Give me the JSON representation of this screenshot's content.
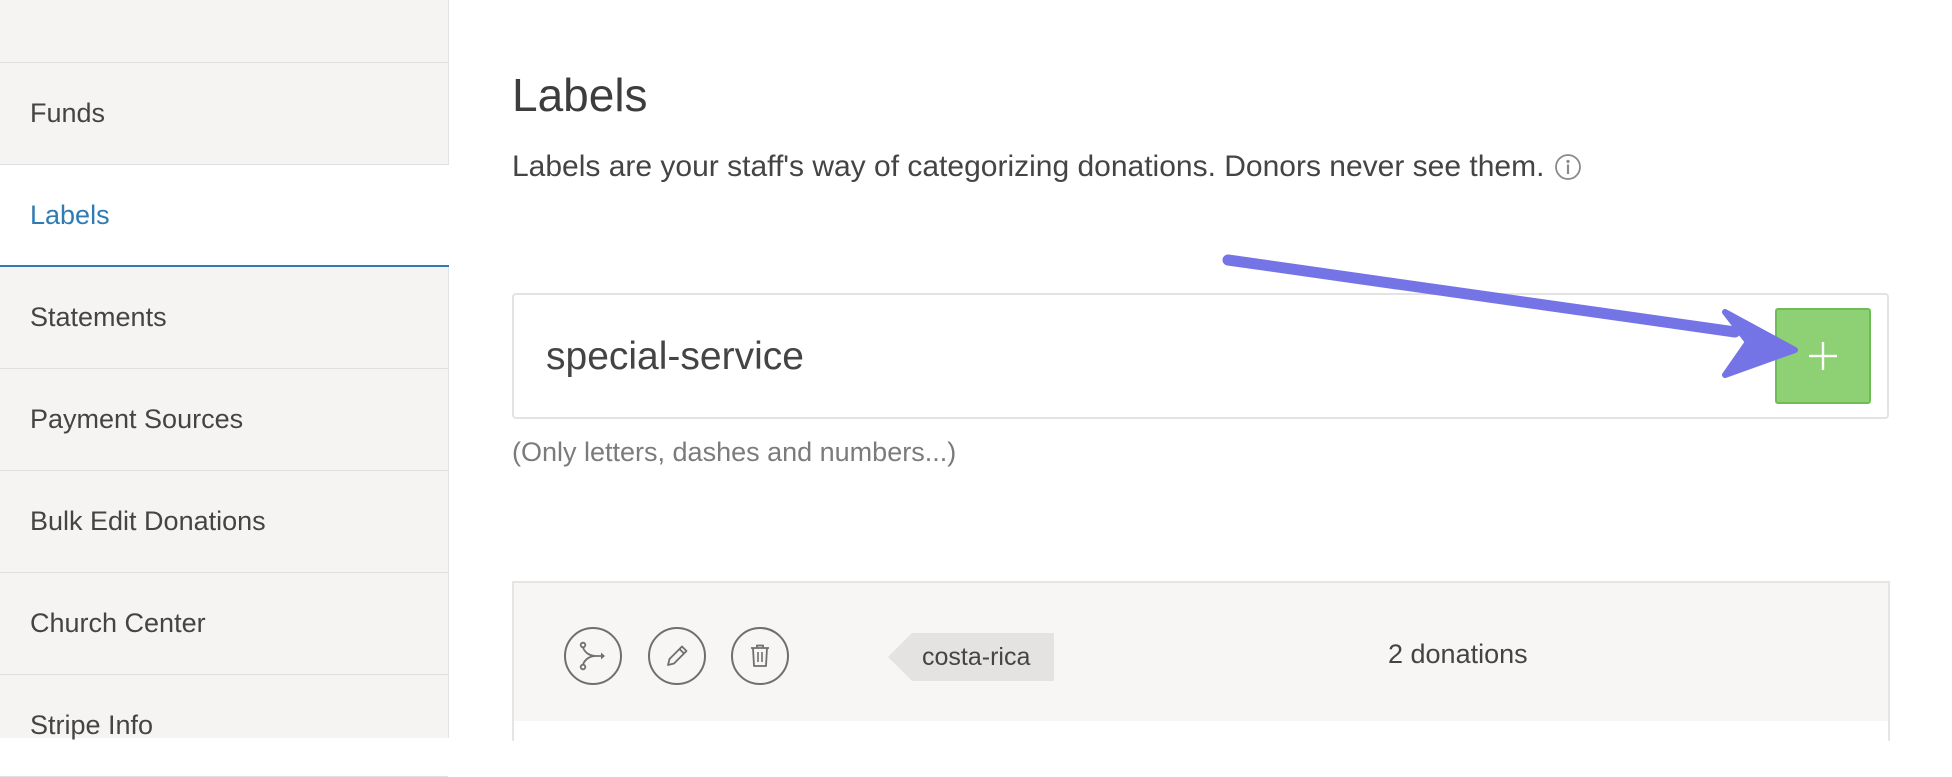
{
  "sidebar": {
    "items": [
      {
        "label": "Funds"
      },
      {
        "label": "Labels"
      },
      {
        "label": "Statements"
      },
      {
        "label": "Payment Sources"
      },
      {
        "label": "Bulk Edit Donations"
      },
      {
        "label": "Church Center"
      },
      {
        "label": "Stripe Info"
      }
    ],
    "active_item": "Labels"
  },
  "main": {
    "title": "Labels",
    "description": "Labels are your staff's way of categorizing donations. Donors never see them.",
    "new_label_input": {
      "value": "special-service"
    },
    "add_button_icon": "plus-icon",
    "hint": "(Only letters, dashes and numbers...)",
    "labels": [
      {
        "name": "costa-rica",
        "donation_count": "2 donations"
      }
    ]
  },
  "icons": {
    "merge": "merge-icon",
    "edit": "pencil-icon",
    "delete": "trash-icon",
    "info": "info-icon"
  },
  "colors": {
    "accent": "#2f7bb5",
    "add_button": "#8ed174",
    "annotation_arrow": "#7474e6"
  }
}
